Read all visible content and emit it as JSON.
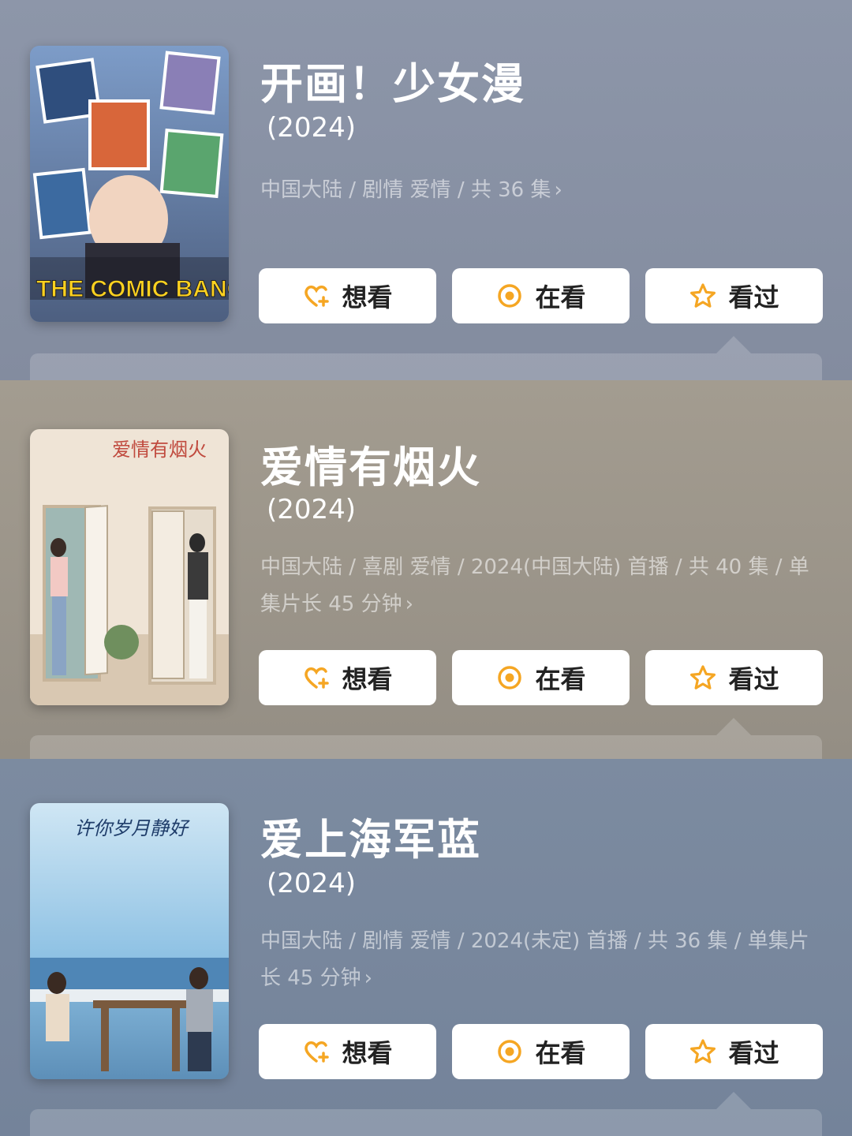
{
  "buttons": {
    "want": "想看",
    "watching": "在看",
    "watched": "看过"
  },
  "colors": {
    "accent": "#f5a623",
    "button_bg": "#ffffff"
  },
  "icons": {
    "want": "heart-plus-icon",
    "watching": "target-dot-icon",
    "watched": "star-icon",
    "more": "chevron-right-icon"
  },
  "items": [
    {
      "title": "开画！少女漫",
      "year": "(2024)",
      "meta": "中国大陆 / 剧情 爱情 / 共 36 集",
      "poster_text": "THE COMIC BANG"
    },
    {
      "title": "爱情有烟火",
      "year": "(2024)",
      "meta": "中国大陆 / 喜剧 爱情 / 2024(中国大陆) 首播 / 共 40 集 / 单集片长 45 分钟",
      "poster_text": "爱情有烟火"
    },
    {
      "title": "爱上海军蓝",
      "year": "(2024)",
      "meta": "中国大陆 / 剧情 爱情 / 2024(未定) 首播 / 共 36 集 / 单集片长 45 分钟",
      "poster_text": "许你岁月静好"
    }
  ]
}
